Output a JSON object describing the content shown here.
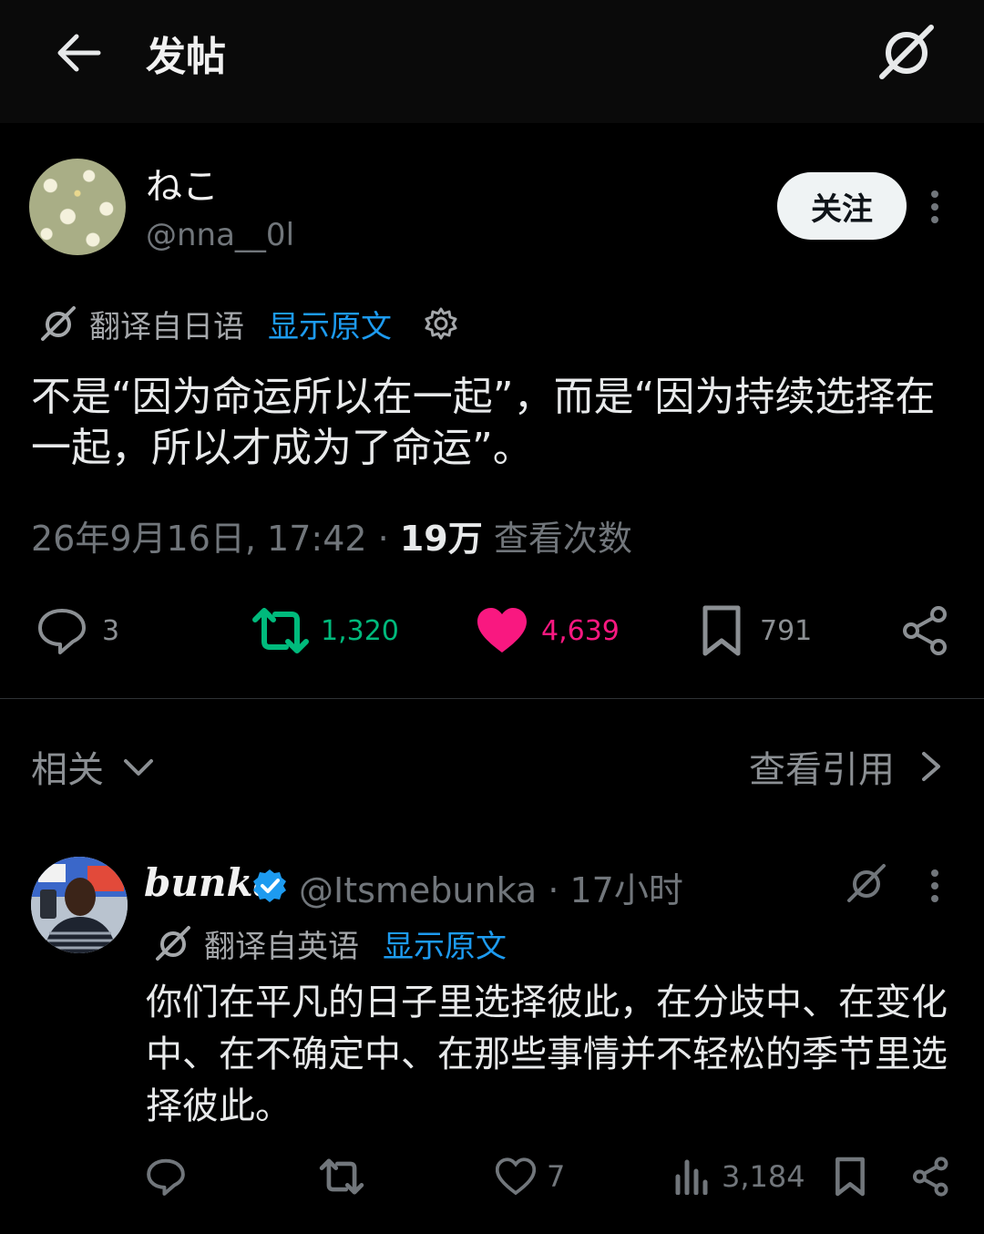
{
  "header": {
    "title": "发帖"
  },
  "post": {
    "display_name": "ねこ",
    "handle": "@nna__0l",
    "follow_label": "关注",
    "translated_from": "翻译自日语",
    "show_original": "显示原文",
    "text": "不是“因为命运所以在一起”，而是“因为持续选择在一起，所以才成为了命运”。",
    "timestamp": "26年9月16日, 17:42",
    "separator": "·",
    "views_count": "19万",
    "views_label": "查看次数",
    "actions": {
      "replies": "3",
      "reposts": "1,320",
      "likes": "4,639",
      "bookmarks": "791"
    }
  },
  "section": {
    "related_label": "相关",
    "quotes_label": "查看引用"
  },
  "reply": {
    "display_name": "bunka",
    "handle": "@Itsmebunka",
    "time": "17小时",
    "translated_from": "翻译自英语",
    "show_original": "显示原文",
    "text": "你们在平凡的日子里选择彼此，在分歧中、在变化中、在不确定中、在那些事情并不轻松的季节里选择彼此。",
    "actions": {
      "likes": "7",
      "views": "3,184"
    }
  },
  "colors": {
    "accent": "#1d9bf0",
    "repost": "#00ba7c",
    "like": "#f91880",
    "muted": "#71767b"
  }
}
